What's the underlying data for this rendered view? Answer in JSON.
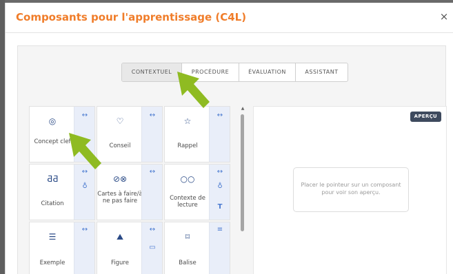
{
  "dialog": {
    "title": "Composants pour l'apprentissage (C4L)",
    "close_label": "×"
  },
  "tabs": [
    {
      "label": "CONTEXTUEL",
      "active": true
    },
    {
      "label": "PROCÉDURE",
      "active": false
    },
    {
      "label": "ÉVALUATION",
      "active": false
    },
    {
      "label": "ASSISTANT",
      "active": false
    }
  ],
  "components": [
    {
      "label": "Concept clef",
      "icon": "target-icon",
      "glyph": "◎",
      "side_icons": [
        "↔"
      ]
    },
    {
      "label": "Conseil",
      "icon": "lightbulb-icon",
      "glyph": "♡",
      "side_icons": [
        "↔"
      ]
    },
    {
      "label": "Rappel",
      "icon": "pin-icon",
      "glyph": "☆",
      "side_icons": [
        "↔"
      ]
    },
    {
      "label": "Citation",
      "icon": "quote-icon",
      "glyph": "ƋƋ",
      "side_icons": [
        "↔",
        "♁"
      ]
    },
    {
      "label": "Cartes à faire/à ne pas faire",
      "icon": "do-dont-icon",
      "glyph": "⊘⊗",
      "side_icons": [
        "↔"
      ]
    },
    {
      "label": "Contexte de lecture",
      "icon": "glasses-icon",
      "glyph": "○○",
      "side_icons": [
        "↔",
        "♁",
        "T"
      ]
    },
    {
      "label": "Exemple",
      "icon": "example-icon",
      "glyph": "☰",
      "side_icons": [
        "↔"
      ]
    },
    {
      "label": "Figure",
      "icon": "mountain-icon",
      "glyph": "⛰",
      "side_icons": [
        "↔",
        "▭"
      ]
    },
    {
      "label": "Balise",
      "icon": "tag-icon",
      "glyph": "⌑",
      "side_icons": [
        "≡"
      ]
    }
  ],
  "preview": {
    "badge": "APERÇU",
    "hint": "Placer le pointeur sur un composant pour voir son aperçu."
  },
  "colors": {
    "title": "#f07d2a",
    "arrow": "#8fbb22",
    "icon": "#2a4a86",
    "side_panel": "#e9eef9"
  }
}
